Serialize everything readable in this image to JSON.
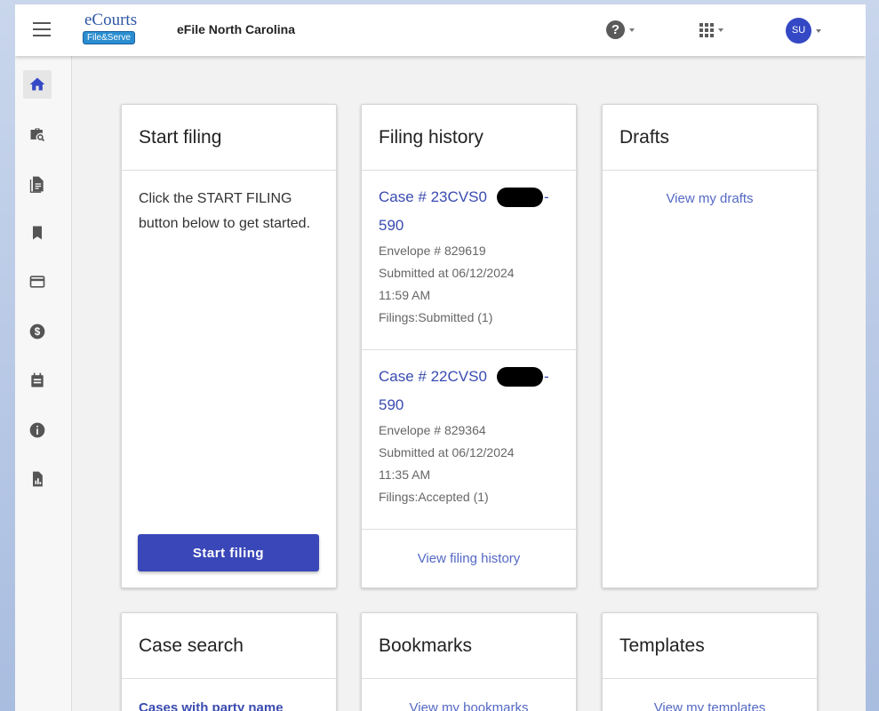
{
  "header": {
    "logo_top": "eCourts",
    "logo_bottom": "File&Serve",
    "app_title": "eFile North Carolina",
    "help_glyph": "?",
    "user_initials": "SU"
  },
  "sidebar": {
    "items": [
      {
        "name": "home-icon",
        "active": true
      },
      {
        "name": "case-search-icon",
        "active": false
      },
      {
        "name": "document-icon",
        "active": false
      },
      {
        "name": "bookmark-icon",
        "active": false
      },
      {
        "name": "payment-card-icon",
        "active": false
      },
      {
        "name": "dollar-icon",
        "active": false
      },
      {
        "name": "calendar-icon",
        "active": false
      },
      {
        "name": "info-icon",
        "active": false
      },
      {
        "name": "report-icon",
        "active": false
      }
    ]
  },
  "cards": {
    "start_filing": {
      "title": "Start filing",
      "description": "Click the START FILING button below to get started.",
      "button_label": "Start filing"
    },
    "filing_history": {
      "title": "Filing history",
      "entries": [
        {
          "case_line1": "Case # 23CVS0",
          "case_line1_suffix": "-",
          "case_line2": "590",
          "envelope": "Envelope # 829619",
          "submitted": "Submitted at 06/12/2024",
          "time": "11:59 AM",
          "filings": "Filings:Submitted (1)"
        },
        {
          "case_line1": "Case # 22CVS0",
          "case_line1_suffix": "-",
          "case_line2": "590",
          "envelope": "Envelope # 829364",
          "submitted": "Submitted at 06/12/2024",
          "time": "11:35 AM",
          "filings": "Filings:Accepted (1)"
        }
      ],
      "link_label": "View filing history"
    },
    "drafts": {
      "title": "Drafts",
      "link_label": "View my drafts"
    },
    "case_search": {
      "title": "Case search",
      "link_label": "Cases with party name"
    },
    "bookmarks": {
      "title": "Bookmarks",
      "link_label": "View my bookmarks"
    },
    "templates": {
      "title": "Templates",
      "link_label": "View my templates"
    }
  },
  "colors": {
    "primary": "#3a47b8",
    "link": "#3949ab",
    "avatar": "#3448c5"
  }
}
